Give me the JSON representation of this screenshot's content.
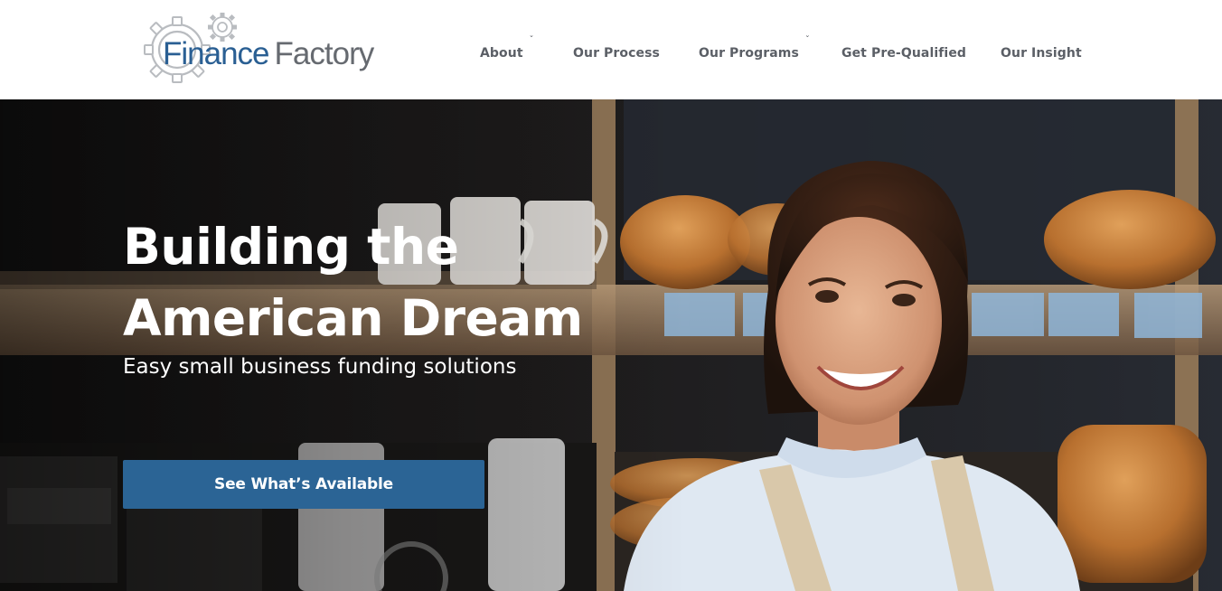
{
  "brand": {
    "name_part1": "Finance",
    "name_part2": "Factory",
    "primary_color": "#2a5f93",
    "secondary_color": "#666a70"
  },
  "nav": {
    "items": [
      {
        "label": "About",
        "has_dropdown": true
      },
      {
        "label": "Our Process",
        "has_dropdown": false
      },
      {
        "label": "Our Programs",
        "has_dropdown": true
      },
      {
        "label": "Get Pre-Qualified",
        "has_dropdown": false
      },
      {
        "label": "Our Insight",
        "has_dropdown": false
      }
    ],
    "dropdown_glyph": "ˇ",
    "text_color": "#5b5f66"
  },
  "hero": {
    "title_line1": "Building the",
    "title_line2": "American Dream",
    "subtitle": "Easy small business funding solutions",
    "cta_label": "See What’s Available",
    "cta_color": "#2b6495",
    "background_image": "smiling-woman-in-bakery-photo"
  },
  "icons": {
    "logo": "gear-icon"
  }
}
